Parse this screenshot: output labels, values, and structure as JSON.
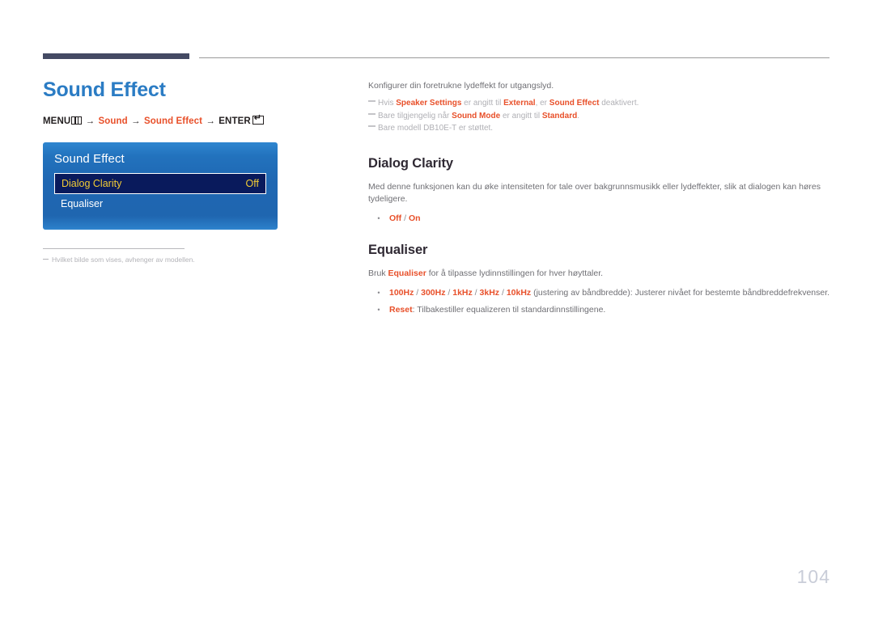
{
  "document": {
    "page_number": "104",
    "page_title": "Sound Effect"
  },
  "breadcrumb": {
    "menu_label": "MENU",
    "menu_icon": "menu-bars-icon",
    "arrow": "→",
    "step_sound": "Sound",
    "step_sound_effect": "Sound Effect",
    "enter_label": "ENTER",
    "enter_icon": "enter-key-icon"
  },
  "osd": {
    "title": "Sound Effect",
    "rows": [
      {
        "label": "Dialog Clarity",
        "value": "Off",
        "selected": true
      },
      {
        "label": "Equaliser",
        "value": "",
        "selected": false
      }
    ]
  },
  "caption": {
    "dash": "–",
    "note": "Hvilket bilde som vises, avhenger av modellen."
  },
  "intro": {
    "text": "Konfigurer din foretrukne lydeffekt for utgangslyd.",
    "notes": [
      {
        "parts": [
          {
            "t": "Hvis ",
            "b": false
          },
          {
            "t": "Speaker Settings",
            "b": true
          },
          {
            "t": " er angitt til ",
            "b": false
          },
          {
            "t": "External",
            "b": true
          },
          {
            "t": ", er ",
            "b": false
          },
          {
            "t": "Sound Effect",
            "b": true
          },
          {
            "t": " deaktivert.",
            "b": false
          }
        ]
      },
      {
        "parts": [
          {
            "t": "Bare tilgjengelig når ",
            "b": false
          },
          {
            "t": "Sound Mode",
            "b": true
          },
          {
            "t": " er angitt til ",
            "b": false
          },
          {
            "t": "Standard",
            "b": true
          },
          {
            "t": ".",
            "b": false
          }
        ]
      },
      {
        "parts": [
          {
            "t": "Bare modell DB10E-T er støttet.",
            "b": false
          }
        ]
      }
    ]
  },
  "sections": [
    {
      "heading": "Dialog Clarity",
      "paragraph": "Med denne funksjonen kan du øke intensiteten for tale over bakgrunnsmusikk eller lydeffekter, slik at dialogen kan høres tydeligere.",
      "bullets": [
        {
          "dot": "•",
          "parts": [
            {
              "t": "Off",
              "b": true
            },
            {
              "t": " / ",
              "b": false,
              "sep": true
            },
            {
              "t": "On",
              "b": true
            }
          ]
        }
      ]
    },
    {
      "heading": "Equaliser",
      "paragraph_parts": [
        {
          "t": "Bruk ",
          "b": false
        },
        {
          "t": "Equaliser",
          "b": true
        },
        {
          "t": " for å tilpasse lydinnstillingen for hver høyttaler.",
          "b": false
        }
      ],
      "bullets": [
        {
          "dot": "•",
          "parts": [
            {
              "t": "100Hz",
              "b": true
            },
            {
              "t": " / ",
              "b": false,
              "sep": true
            },
            {
              "t": "300Hz",
              "b": true
            },
            {
              "t": " / ",
              "b": false,
              "sep": true
            },
            {
              "t": "1kHz",
              "b": true
            },
            {
              "t": " / ",
              "b": false,
              "sep": true
            },
            {
              "t": "3kHz",
              "b": true
            },
            {
              "t": " / ",
              "b": false,
              "sep": true
            },
            {
              "t": "10kHz",
              "b": true
            },
            {
              "t": " (justering av båndbredde): Justerer nivået for bestemte båndbreddefrekvenser.",
              "b": false
            }
          ]
        },
        {
          "dot": "•",
          "parts": [
            {
              "t": "Reset",
              "b": true
            },
            {
              "t": ": Tilbakestiller equalizeren til standardinnstillingene.",
              "b": false
            }
          ]
        }
      ]
    }
  ],
  "colors": {
    "title_blue": "#2b7cc4",
    "accent_orange": "#e8502a",
    "osd_blue": "#1f67b2",
    "osd_selected_bg": "#091a5c",
    "osd_selected_text": "#f2cc35",
    "rule_navy": "#444a63",
    "body_gray": "#6f6f74",
    "note_gray": "#b0b0b5",
    "page_number_gray": "#c9cdd8"
  }
}
